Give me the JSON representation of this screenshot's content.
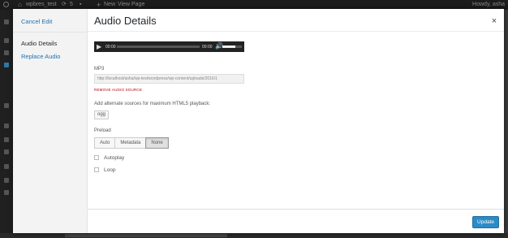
{
  "adminbar": {
    "site_name": "wpbres_test",
    "updates_count": "5",
    "new_label": "New",
    "view_page_label": "View Page",
    "howdy": "Howdy, asha"
  },
  "modal": {
    "title": "Audio Details",
    "close_icon": "×",
    "menu": {
      "cancel_edit": "Cancel Edit",
      "audio_details": "Audio Details",
      "replace_audio": "Replace Audio"
    },
    "player": {
      "current_time": "00:00",
      "duration": "00:00",
      "volume": 0.67
    },
    "file_type": "MP3",
    "source_url": "http://localhost/asha/wp-test/wordpress/wp-content/uploads/2016/1",
    "remove_label": "REMOVE AUDIO SOURCE",
    "alt_sources_label": "Add alternate sources for maximum HTML5 playback:",
    "alt_sources": [
      "ogg"
    ],
    "preload_label": "Preload",
    "preload_options": [
      "Auto",
      "Metadata",
      "None"
    ],
    "preload_selected": "None",
    "autoplay_label": "Autoplay",
    "loop_label": "Loop",
    "update_label": "Update"
  },
  "colors": {
    "accent": "#2271b1",
    "update_button": "#2b8bc6",
    "remove_link": "#aa0000"
  }
}
